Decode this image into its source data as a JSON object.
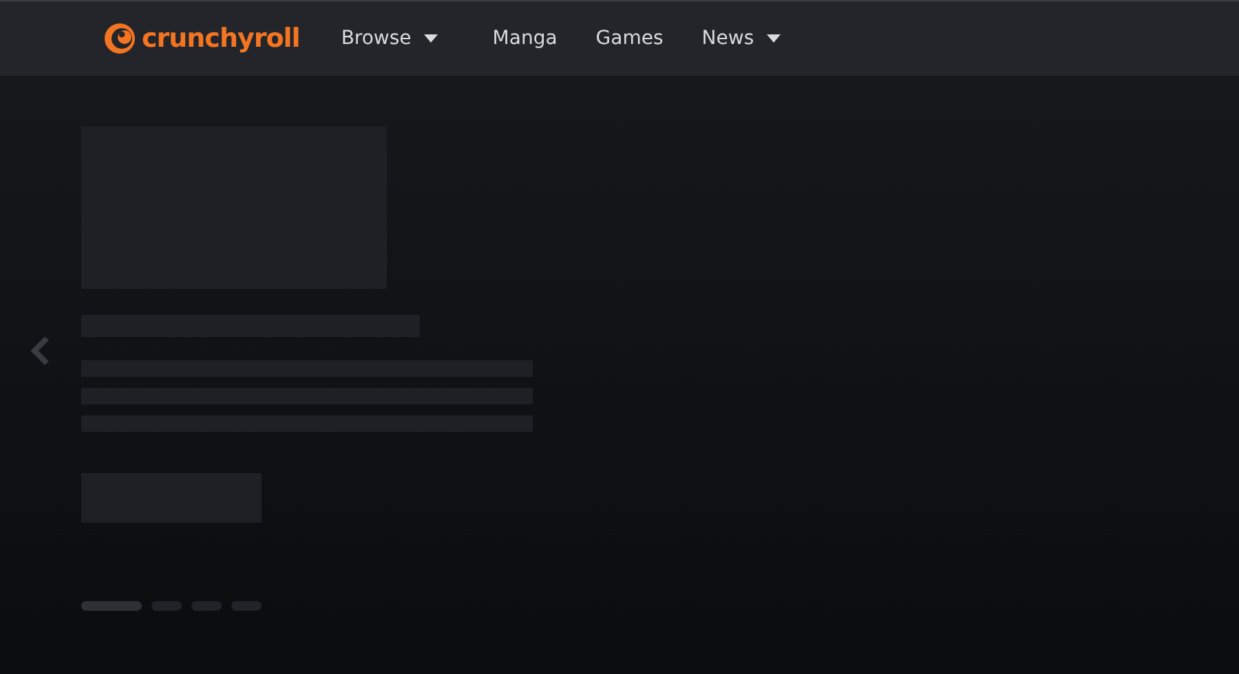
{
  "header": {
    "logo": "crunchyroll",
    "nav": [
      {
        "label": "Browse",
        "dropdown": true
      },
      {
        "label": "Manga",
        "dropdown": false
      },
      {
        "label": "Games",
        "dropdown": false
      },
      {
        "label": "News",
        "dropdown": true
      }
    ]
  },
  "carousel": {
    "slides": [
      {
        "selected": true
      },
      {
        "selected": false
      },
      {
        "selected": false
      },
      {
        "selected": false
      }
    ]
  }
}
